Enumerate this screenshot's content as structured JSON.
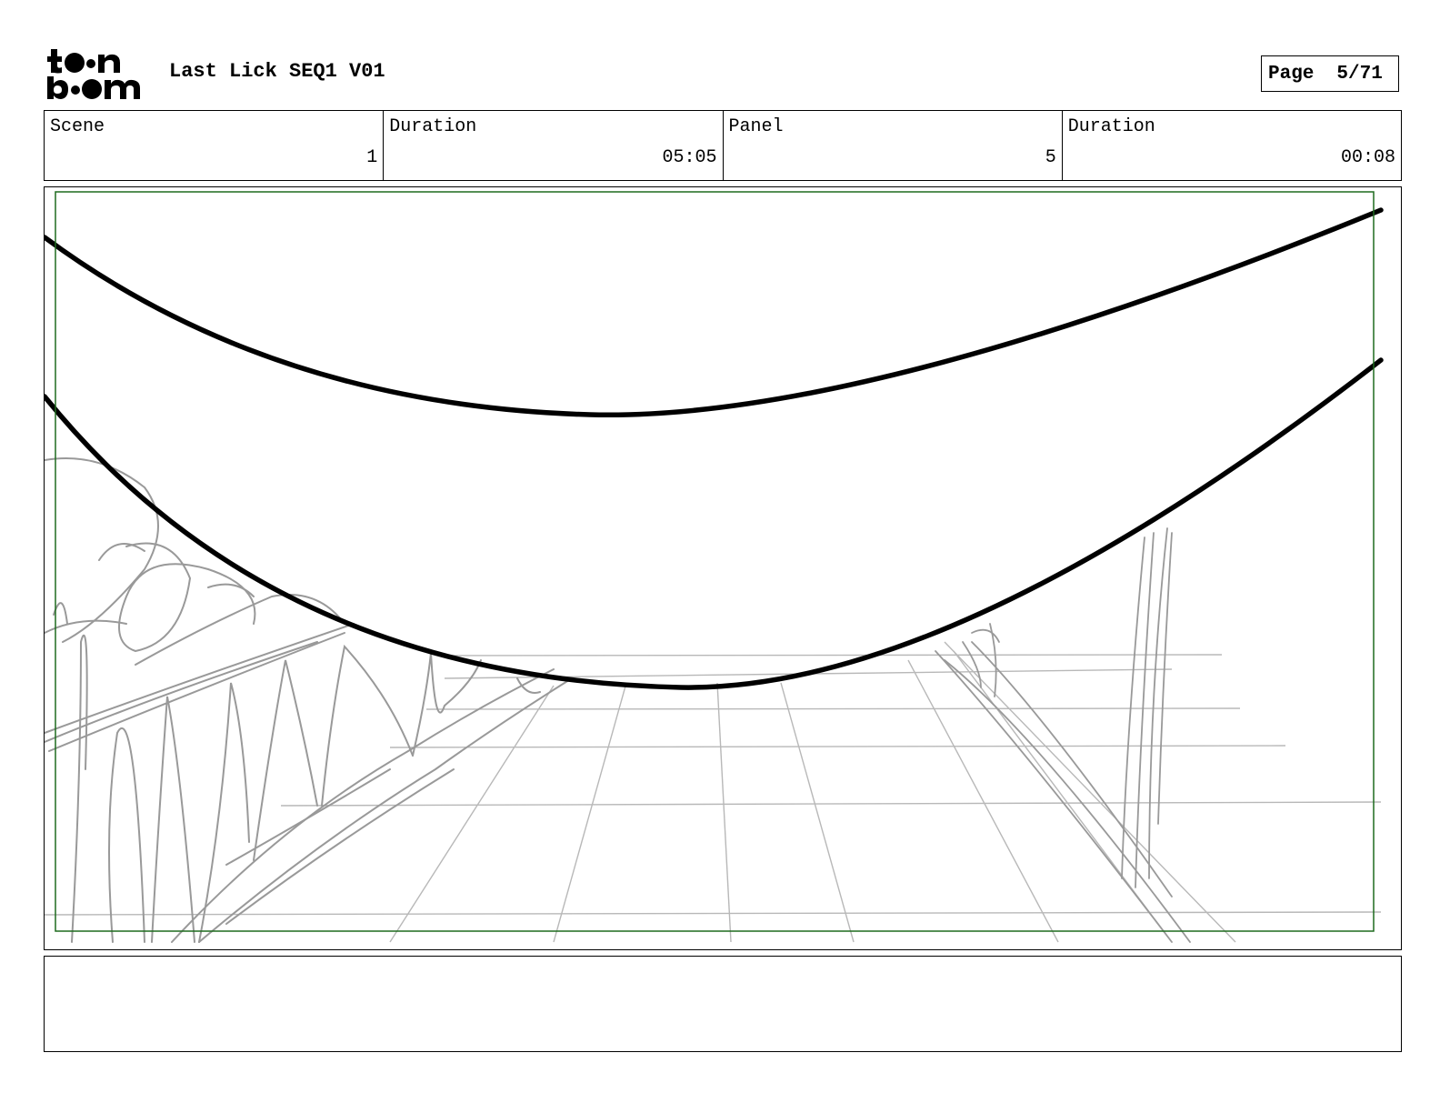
{
  "header": {
    "logo_text": "toon boom",
    "title": "Last Lick SEQ1 V01",
    "page_label": "Page",
    "page_value": "5/71"
  },
  "info": {
    "scene_label": "Scene",
    "scene_value": "1",
    "scene_duration_label": "Duration",
    "scene_duration_value": "05:05",
    "panel_label": "Panel",
    "panel_value": "5",
    "panel_duration_label": "Duration",
    "panel_duration_value": "00:08"
  },
  "panel": {
    "safe_frame_color": "#1e6b1e",
    "ink_color": "#000000",
    "sketch_color": "#9a9a9a"
  },
  "notes": {
    "text": ""
  }
}
